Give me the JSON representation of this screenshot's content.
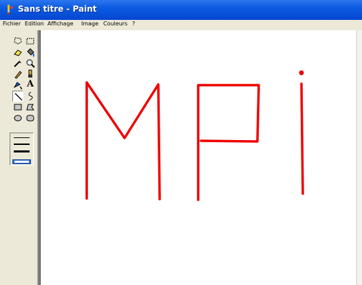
{
  "window": {
    "title": "Sans titre - Paint",
    "app_icon": "paint-palette-icon"
  },
  "menu": [
    "Fichier",
    "Edition",
    "Affichage",
    "Image",
    "Couleurs",
    "?"
  ],
  "toolbox": {
    "tools": [
      {
        "name": "free-form-select-icon"
      },
      {
        "name": "rect-select-icon"
      },
      {
        "name": "eraser-icon"
      },
      {
        "name": "fill-bucket-icon"
      },
      {
        "name": "color-picker-icon"
      },
      {
        "name": "magnifier-icon"
      },
      {
        "name": "pencil-icon"
      },
      {
        "name": "brush-icon"
      },
      {
        "name": "airbrush-icon"
      },
      {
        "name": "text-icon",
        "label": "A"
      },
      {
        "name": "line-icon",
        "active": true
      },
      {
        "name": "curve-icon"
      },
      {
        "name": "rectangle-icon"
      },
      {
        "name": "polygon-icon"
      },
      {
        "name": "ellipse-icon"
      },
      {
        "name": "rounded-rect-icon"
      }
    ],
    "line_widths": [
      1,
      2,
      3,
      4
    ],
    "selected_line_width": 4
  },
  "canvas": {
    "background": "#ffffff",
    "stroke_color": "#ee0000"
  },
  "colors": {
    "titlebar": "#0a5be0",
    "chrome": "#ece9d8",
    "workspace": "#808080",
    "selection": "#3169c6"
  }
}
